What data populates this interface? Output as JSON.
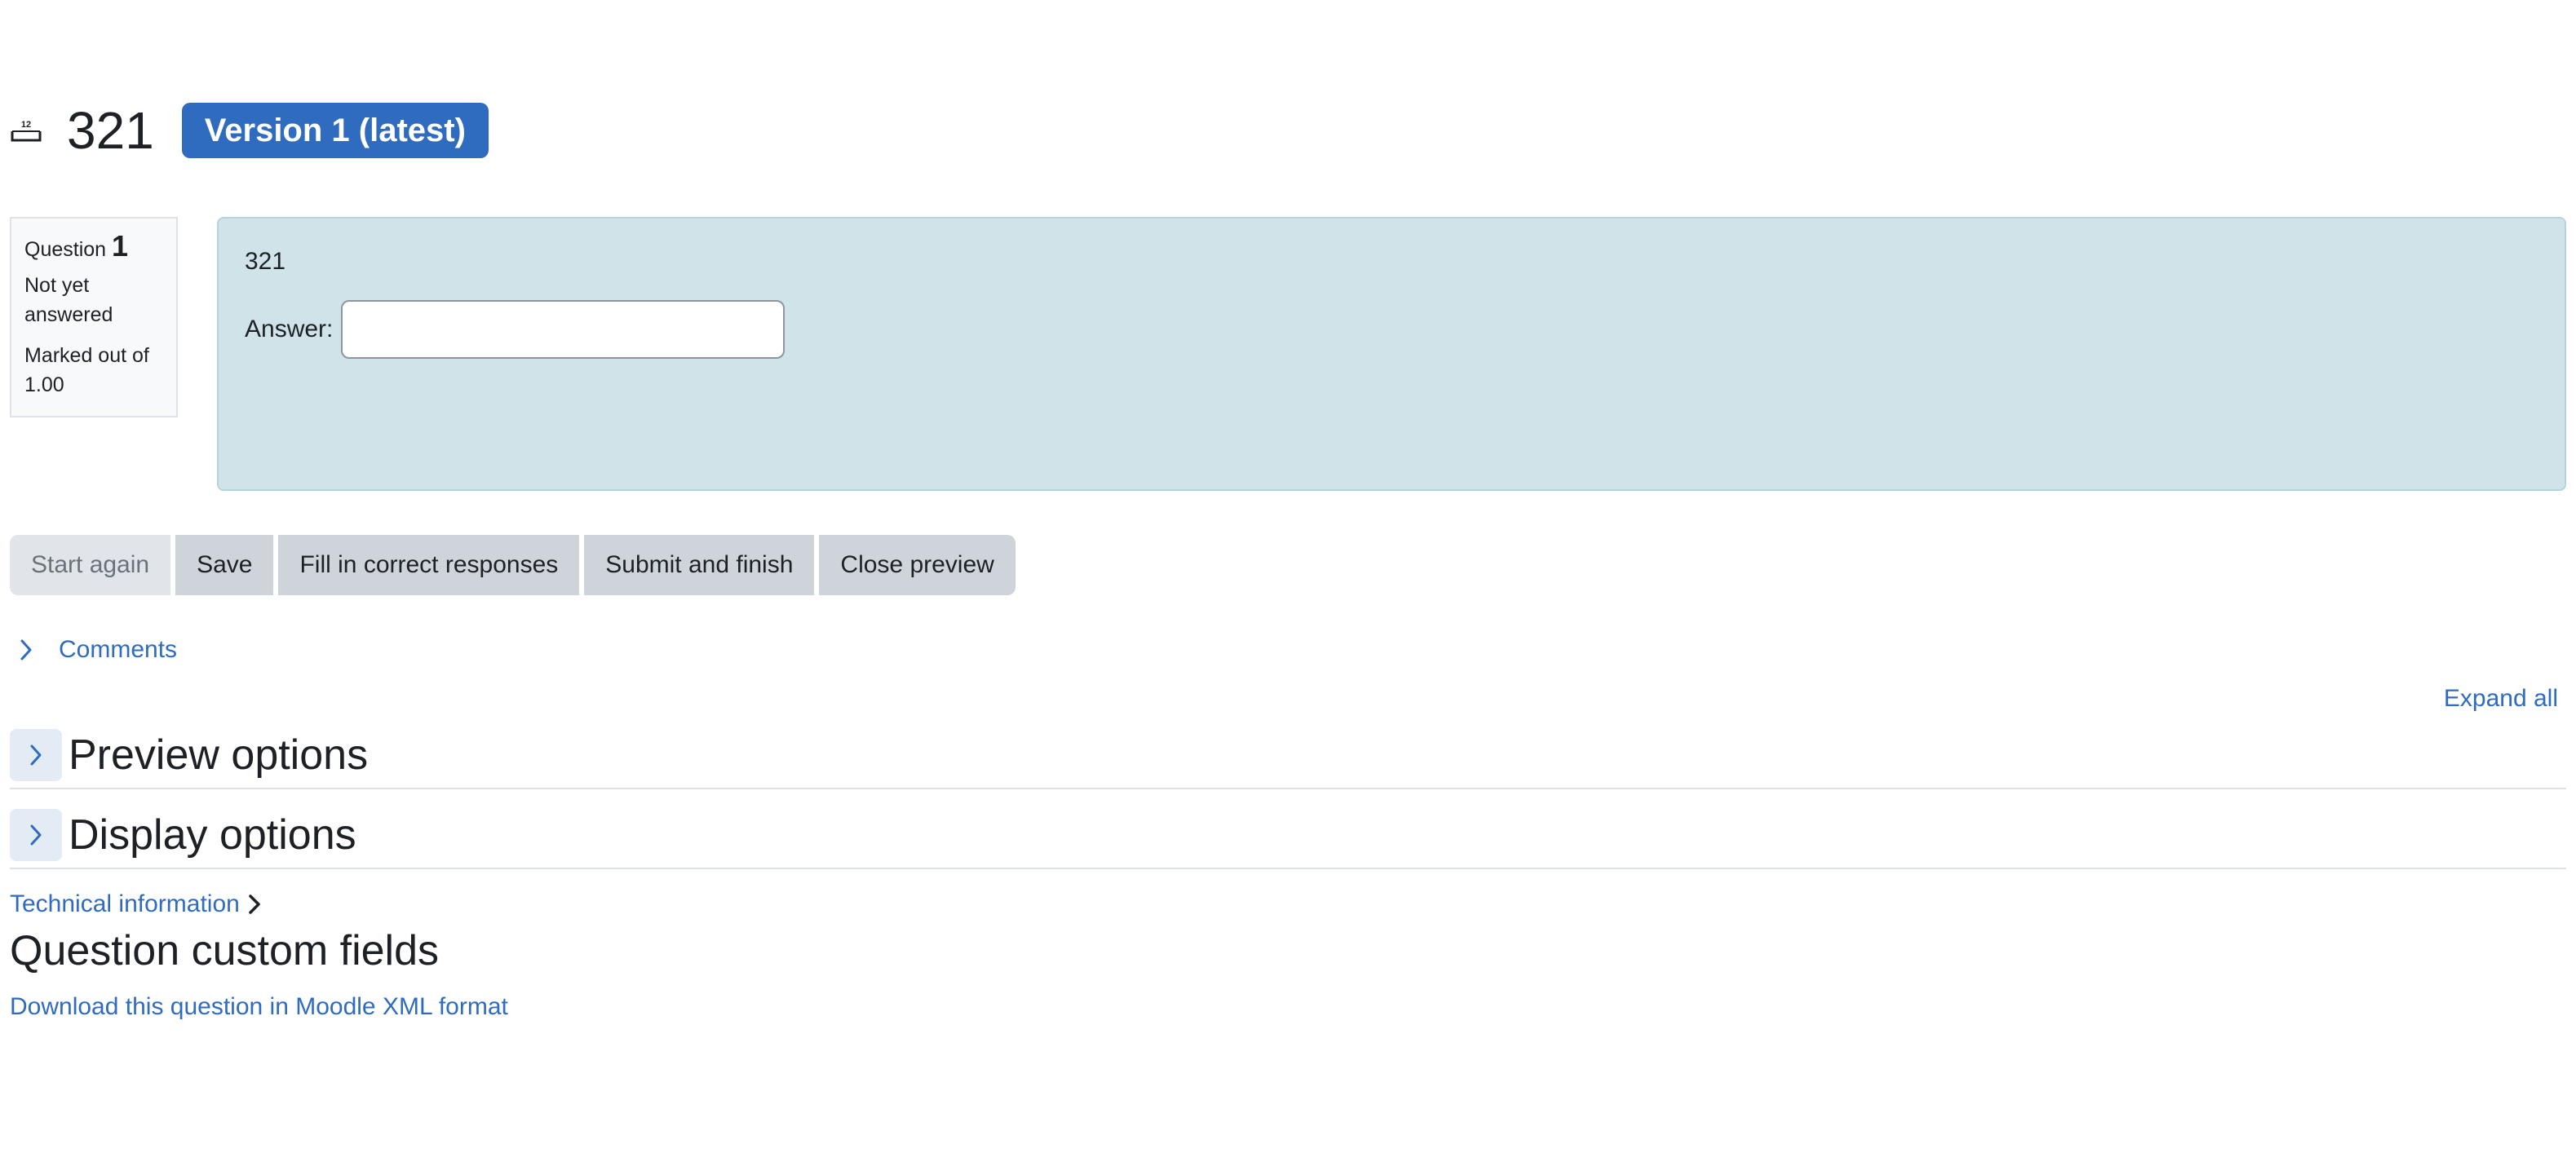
{
  "header": {
    "qtype_icon": "numerical-question-icon",
    "title": "321",
    "version_badge": "Version 1 (latest)"
  },
  "question_info": {
    "question_label": "Question",
    "question_number": "1",
    "state": "Not yet answered",
    "marked_out_of": "Marked out of 1.00"
  },
  "formulation": {
    "question_text": "321",
    "answer_label": "Answer:",
    "answer_value": ""
  },
  "buttons": {
    "start_again": "Start again",
    "save": "Save",
    "fill_correct": "Fill in correct responses",
    "submit_finish": "Submit and finish",
    "close_preview": "Close preview"
  },
  "comments": {
    "label": "Comments",
    "icon": "chevron-right-icon"
  },
  "expand_all": "Expand all",
  "sections": {
    "preview_options": "Preview options",
    "display_options": "Display options"
  },
  "technical_info": "Technical information",
  "custom_fields_heading": "Question custom fields",
  "download_link": "Download this question in Moodle XML format",
  "colors": {
    "accent": "#2f6bbf",
    "formulation_bg": "#cfe3e8",
    "button_bg": "#ced4da"
  }
}
